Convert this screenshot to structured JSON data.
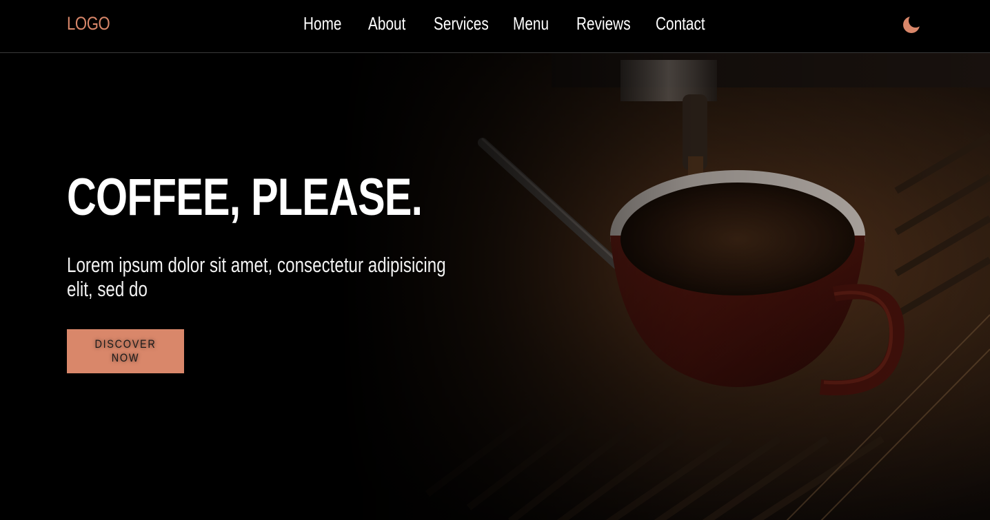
{
  "header": {
    "logo": "LOGO",
    "nav": [
      {
        "label": "Home"
      },
      {
        "label": "About"
      },
      {
        "label": "Services"
      },
      {
        "label": "Menu"
      },
      {
        "label": "Reviews"
      },
      {
        "label": "Contact"
      }
    ],
    "theme_toggle_icon": "moon-icon"
  },
  "hero": {
    "title": "COFFEE, PLEASE.",
    "text": "Lorem ipsum dolor sit amet, consectetur adipisicing elit, sed do",
    "cta_label": "DISCOVER NOW",
    "background_image": "espresso-cup-under-machine"
  },
  "colors": {
    "accent": "#d9876a",
    "background": "#000000",
    "text": "#ffffff"
  }
}
